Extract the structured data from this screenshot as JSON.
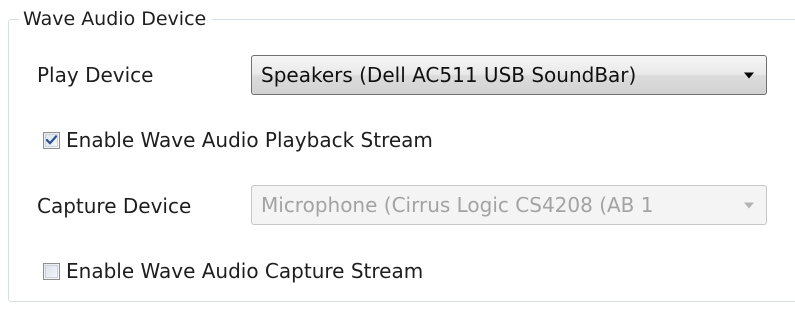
{
  "group": {
    "title": "Wave Audio Device"
  },
  "play_device": {
    "label": "Play Device",
    "selected": "Speakers (Dell AC511 USB SoundBar)"
  },
  "enable_playback": {
    "label": "Enable Wave Audio Playback Stream",
    "checked": true
  },
  "capture_device": {
    "label": "Capture Device",
    "selected": "Microphone (Cirrus Logic CS4208 (AB 1",
    "enabled": false
  },
  "enable_capture": {
    "label": "Enable Wave Audio Capture Stream",
    "checked": false
  },
  "colors": {
    "check_mark": "#2b4f8e",
    "arrow_enabled": "#000000",
    "arrow_disabled": "#b4b4b4"
  },
  "icons": {
    "dropdown": "chevron-down-icon",
    "check": "checkmark-icon"
  }
}
